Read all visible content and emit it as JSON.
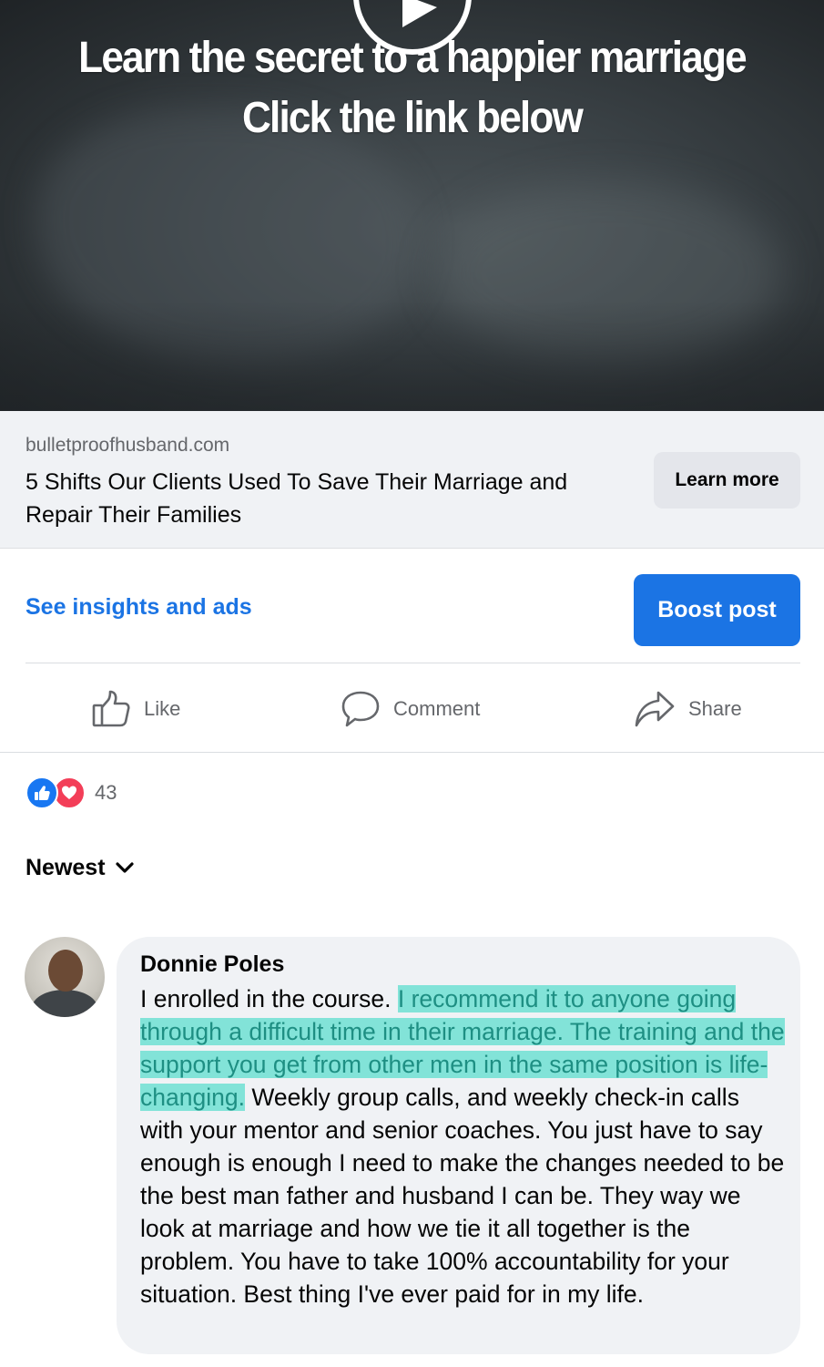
{
  "video": {
    "headline_line1": "Learn the secret to a happier marriage",
    "headline_line2": "Click the link below"
  },
  "link_preview": {
    "domain": "bulletproofhusband.com",
    "title": "5 Shifts Our Clients Used To Save Their Marriage and Repair Their Families",
    "cta_label": "Learn more"
  },
  "insights": {
    "link_label": "See insights and ads",
    "boost_label": "Boost post"
  },
  "actions": {
    "like_label": "Like",
    "comment_label": "Comment",
    "share_label": "Share"
  },
  "reactions": {
    "count": "43",
    "icons": [
      "like-icon",
      "love-icon"
    ],
    "like_color": "#1877f2",
    "love_color": "#f33e58"
  },
  "comments": {
    "sort_label": "Newest",
    "items": [
      {
        "author": "Donnie Poles",
        "text_before": "I enrolled in the course.",
        "text_highlighted": "I recommend it to anyone going through a difficult time in their marriage. The training and the support you get from other men in the same position is life-changing.",
        "text_after": "Weekly group calls, and weekly check-in calls with your mentor and senior coaches. You just have to say enough is enough I need to make the changes needed to be the best man father and husband I can be. They way we look at marriage and how we tie it all together is the problem. You have to take 100% accountability for your situation. Best thing I've ever paid for in my life."
      }
    ]
  },
  "colors": {
    "accent_blue": "#1b74e4",
    "highlight": "#6ee1d2"
  }
}
